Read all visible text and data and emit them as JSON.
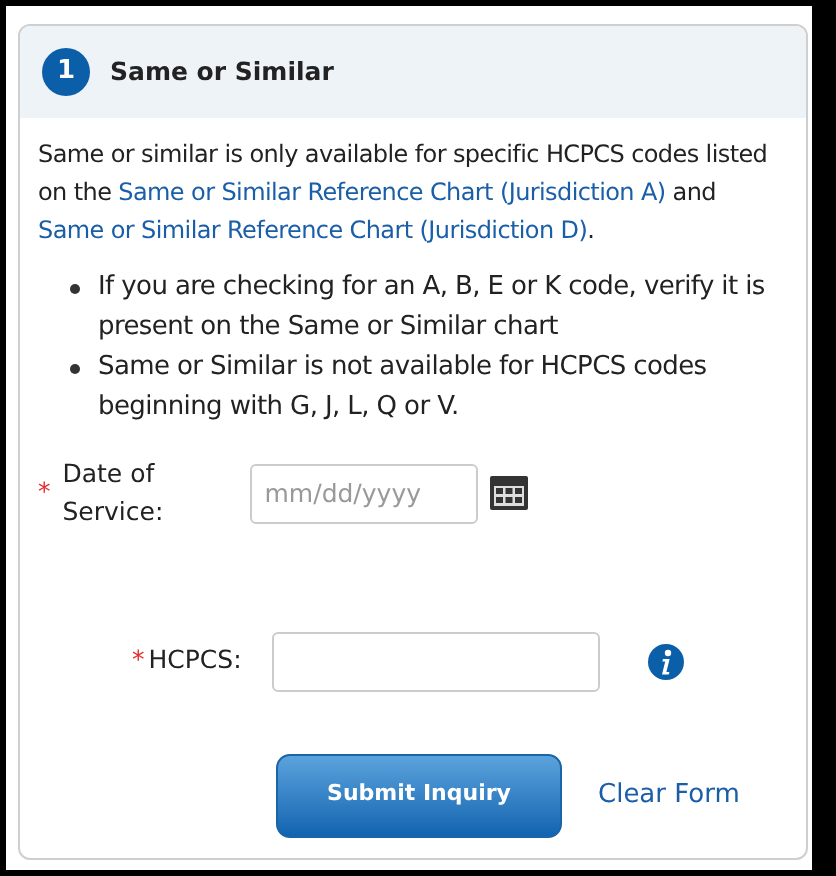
{
  "step": {
    "number": "1",
    "title": "Same or Similar"
  },
  "intro": [
    {
      "kind": "text",
      "text": "Same or similar is only available for specific HCPCS codes listed on the "
    },
    {
      "kind": "link",
      "text": "Same or Similar Reference Chart (Jurisdiction A)"
    },
    {
      "kind": "text",
      "text": " and "
    },
    {
      "kind": "link",
      "text": "Same or Similar Reference Chart (Jurisdiction D)"
    },
    {
      "kind": "text",
      "text": "."
    }
  ],
  "bullets": [
    "If you are checking for an A, B, E or K code, verify it is present on the Same or Similar chart",
    "Same or Similar is not available for HCPCS codes beginning with G, J, L, Q or V."
  ],
  "date_field": {
    "required_mark": "*",
    "label": "Date of Service:",
    "placeholder": "mm/dd/yyyy"
  },
  "hcpcs_field": {
    "required_mark": "*",
    "label": "HCPCS:"
  },
  "submit_button": "Submit Inquiry",
  "clear_link": "Clear Form"
}
